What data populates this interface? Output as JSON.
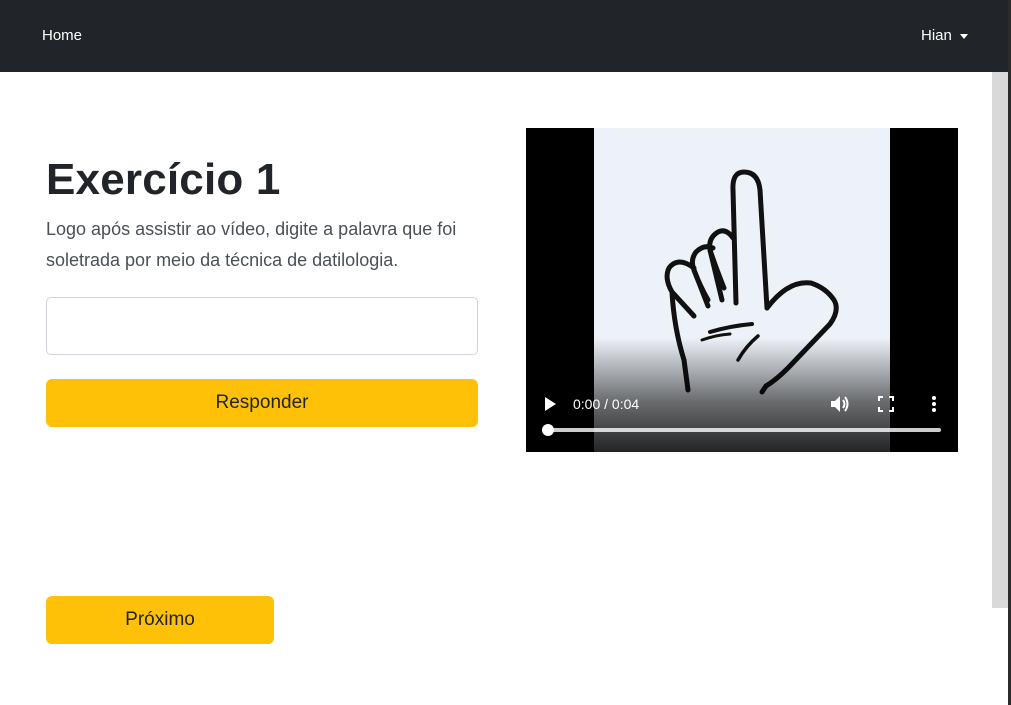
{
  "navbar": {
    "home_label": "Home",
    "user_label": "Hian",
    "background": "#212529"
  },
  "exercise": {
    "title": "Exercício 1",
    "instructions": "Logo após assistir ao vídeo, digite a palavra que foi soletrada por meio da técnica de datilologia.",
    "answer_value": "",
    "answer_placeholder": "",
    "submit_label": "Responder",
    "next_label": "Próximo"
  },
  "video": {
    "time_display": "0:00 / 0:04",
    "progress": 0,
    "icons": {
      "play": "play-icon",
      "volume": "volume-icon",
      "fullscreen": "fullscreen-icon",
      "more": "more-vertical-icon"
    }
  },
  "colors": {
    "accent": "#ffc107",
    "text_dark": "#212529",
    "text_muted": "#495057"
  }
}
